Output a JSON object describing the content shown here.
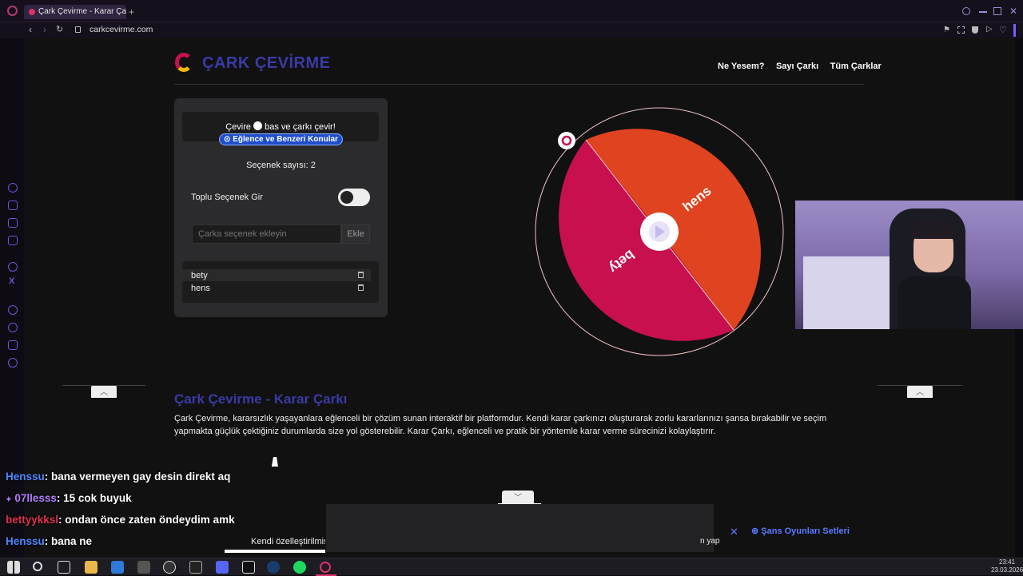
{
  "browser": {
    "tab_title": "Çark Çevirme - Karar Çarkı",
    "new_tab": "+",
    "url": "carkcevirme.com"
  },
  "site": {
    "logo_text": "ÇARK ÇEVİRME",
    "nav": [
      "Ne Yesem?",
      "Sayı Çarkı",
      "Tüm Çarklar"
    ],
    "instruction_pre": "Çevire",
    "instruction_post": "bas ve çarkı çevir!",
    "category_button": "Eğlence ve Benzeri Konular",
    "option_count": "Seçenek sayısı: 2",
    "bulk_label": "Toplu Seçenek Gir",
    "add_placeholder": "Çarka seçenek ekleyin",
    "add_button": "Ekle",
    "options": [
      "bety",
      "hens"
    ],
    "wheel_labels": [
      "hens",
      "bety"
    ],
    "heading": "Çark Çevirme - Karar Çarkı",
    "description": "Çark Çevirme, kararsızlık yaşayanlara eğlenceli bir çözüm sunan interaktif bir platformdur. Kendi karar çarkınızı oluşturarak zorlu kararlarınızı şansa bırakabilir ve seçim yapmakta güçlük çektiğiniz durumlarda size yol gösterebilir. Karar Çarkı, eğlenceli ve pratik bir yöntemle karar verme sürecinizi kolaylaştırır.",
    "cut_text_left": "Kendi özelleştirilmiş",
    "cut_text_right": "n yap",
    "chance_sets": "Şans Oyunları Setleri"
  },
  "colors": {
    "wheel_hens": "#e0431f",
    "wheel_bety": "#c8104e",
    "accent": "#3a3aa6",
    "link": "#5b7bff"
  },
  "chat": [
    {
      "user": "Henssu",
      "message": ": bana vermeyen gay desin direkt aq",
      "color": "#4f88ff"
    },
    {
      "user": "07llesss",
      "message": ": 15 cok buyuk",
      "color": "#b37bff"
    },
    {
      "user": "bettyykksl",
      "message": ": ondan önce zaten öndeydim amk",
      "color": "#e0304e"
    },
    {
      "user": "Henssu",
      "message": ": bana ne",
      "color": "#4f88ff"
    }
  ],
  "taskbar": {
    "time": "23:41",
    "date": "23.03.2026"
  }
}
